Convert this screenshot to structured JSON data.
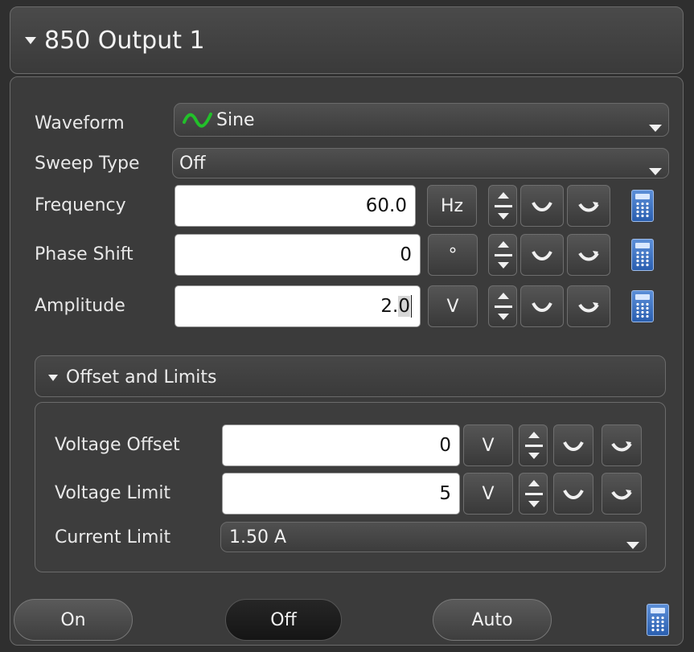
{
  "header": {
    "title": "850 Output 1"
  },
  "waveform": {
    "label": "Waveform",
    "value": "Sine",
    "icon": "sine-wave-icon",
    "icon_color": "#22c02a"
  },
  "sweep": {
    "label": "Sweep Type",
    "value": "Off"
  },
  "frequency": {
    "label": "Frequency",
    "value": "60.0",
    "unit": "Hz"
  },
  "phase": {
    "label": "Phase Shift",
    "value": "0",
    "unit": "°"
  },
  "amplitude": {
    "label": "Amplitude",
    "value_main": "2.",
    "value_selected": "0",
    "unit": "V"
  },
  "offset_section": {
    "title": "Offset and Limits",
    "voltage_offset": {
      "label": "Voltage Offset",
      "value": "0",
      "unit": "V"
    },
    "voltage_limit": {
      "label": "Voltage Limit",
      "value": "5",
      "unit": "V"
    },
    "current_limit": {
      "label": "Current Limit",
      "value": "1.50 A"
    }
  },
  "footer": {
    "on_label": "On",
    "off_label": "Off",
    "auto_label": "Auto"
  }
}
